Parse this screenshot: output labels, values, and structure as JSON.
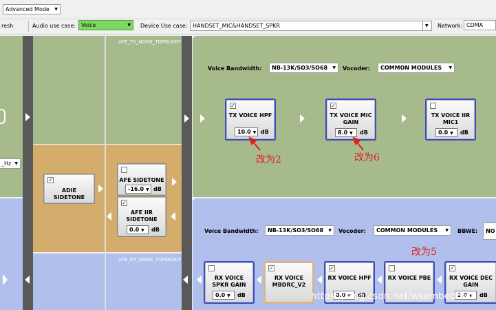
{
  "toolbar": {
    "mode": "Advanced Mode",
    "refresh": "resh",
    "audio_use_case_label": "Audio use case:",
    "audio_use_case_value": "Voice",
    "device_use_case_label": "Device Use case:",
    "device_use_case_value": "HANDSET_MIC&HANDSET_SPKR",
    "network_label": "Network:",
    "network_value": "CDMA"
  },
  "topologies": {
    "tx": "AFE_TX_NONE_TOPOLOGY",
    "rx": "AFE_RX_NONE_TOPOLOGY"
  },
  "left_partial_select": "_Hz",
  "tx": {
    "voice_bandwidth_label": "Voice Bandwidth:",
    "voice_bandwidth_value": "NB-13K/SO3/SO68",
    "vocoder_label": "Vocoder:",
    "vocoder_value": "COMMON MODULES",
    "modules": [
      {
        "title1": "TX VOICE HPF",
        "title2": "",
        "checked": true,
        "value": "10.0",
        "unit": "dB"
      },
      {
        "title1": "TX VOICE MIC",
        "title2": "GAIN",
        "checked": true,
        "value": "8.0",
        "unit": "dB"
      },
      {
        "title1": "TX VOICE IIR",
        "title2": "MIC1",
        "checked": false,
        "value": "0.0",
        "unit": "dB"
      }
    ]
  },
  "sidetone": {
    "adie_title1": "ADIE",
    "adie_title2": "SIDETONE",
    "afe_title": "AFE SIDETONE",
    "afe_value": "-16.0",
    "afe_unit": "dB",
    "iir_title1": "AFE IIR",
    "iir_title2": "SIDETONE",
    "iir_value": "0.0",
    "iir_unit": "dB"
  },
  "rx": {
    "voice_bandwidth_label": "Voice Bandwidth:",
    "voice_bandwidth_value": "NB-13K/SO3/SO68",
    "vocoder_label": "Vocoder:",
    "vocoder_value": "COMMON MODULES",
    "bbwe_label": "BBWE:",
    "bbwe_value": "NO",
    "modules": [
      {
        "title1": "RX VOICE",
        "title2": "SPKR GAIN",
        "checked": false,
        "value": "0.0",
        "unit": "dB"
      },
      {
        "title1": "RX VOICE",
        "title2": "MBDRC_V2",
        "checked": true,
        "value": "",
        "unit": ""
      },
      {
        "title1": "RX VOICE HPF",
        "title2": "",
        "checked": true,
        "value": "0.0",
        "unit": "dB"
      },
      {
        "title1": "RX VOICE PBE",
        "title2": "",
        "checked": false,
        "value": "",
        "unit": ""
      },
      {
        "title1": "RX VOICE DEC",
        "title2": "GAIN",
        "checked": true,
        "value": "2.0",
        "unit": "dB"
      }
    ]
  },
  "annotations": {
    "a1": "改为2",
    "a2": "改为6",
    "a3": "改为5"
  },
  "watermark": "https://blog.csdn.net/wkembedded",
  "colors": {
    "green_pane": "#a6ba8c",
    "tan_pane": "#d4ad6c",
    "blue_pane": "#b0bfec",
    "module_border": "#3e4cc0",
    "annotation_red": "#e02020"
  }
}
